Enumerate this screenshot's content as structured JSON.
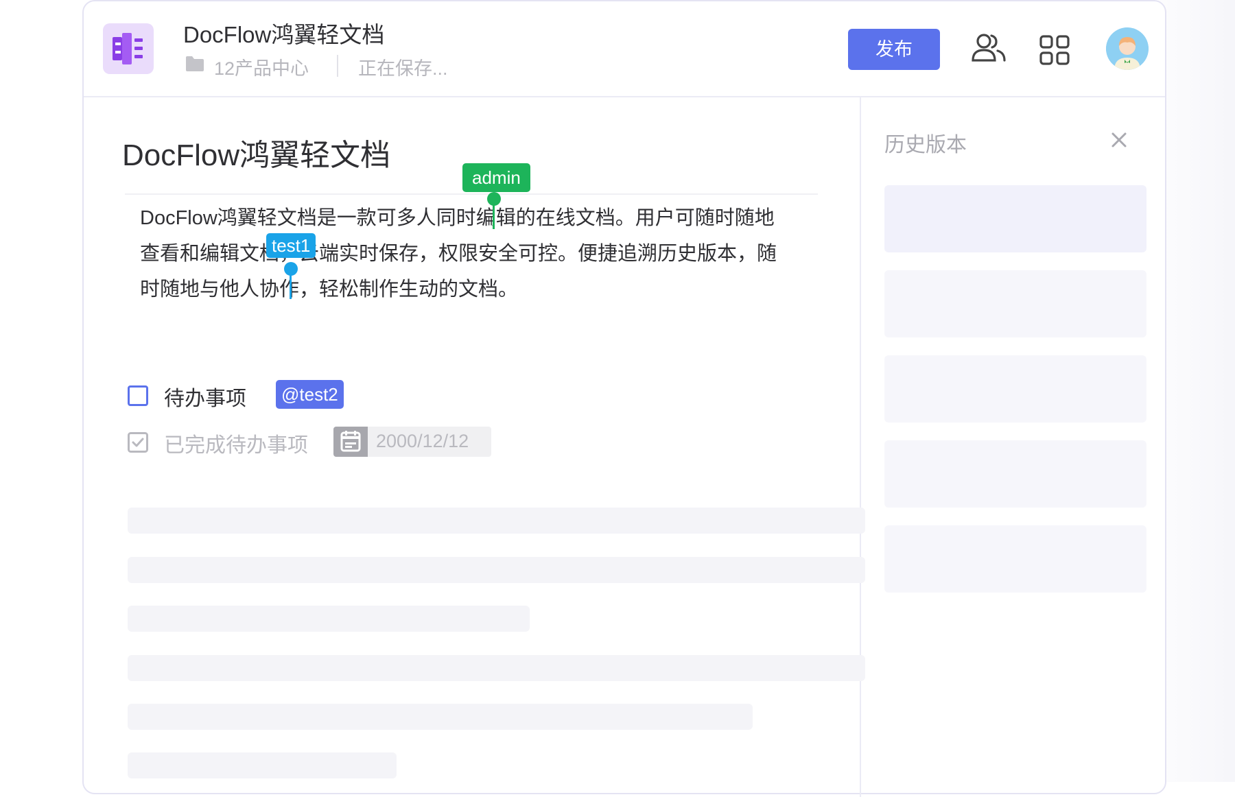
{
  "header": {
    "doc_title": "DocFlow鸿翼轻文档",
    "folder_name": "12产品中心",
    "save_status": "正在保存...",
    "publish_label": "发布"
  },
  "editor": {
    "title": "DocFlow鸿翼轻文档",
    "paragraph_lines": [
      "DocFlow鸿翼轻文档是一款可多人同时编辑的在线文档。用户可随时随地",
      "查看和编辑文档，云端实时保存，权限安全可控。便捷追溯历史版本，随",
      "时随地与他人协作，轻松制作生动的文档。"
    ],
    "cursor_users": [
      {
        "name": "admin",
        "color": "#1db45a"
      },
      {
        "name": "test1",
        "color": "#1aa3e8"
      }
    ],
    "todo": {
      "label": "待办事项",
      "mention": "@test2",
      "checked": false
    },
    "done_todo": {
      "label": "已完成待办事项",
      "date": "2000/12/12",
      "checked": true
    }
  },
  "history": {
    "title": "历史版本"
  },
  "colors": {
    "accent": "#5b72ec",
    "admin_cursor": "#1db45a",
    "test1_cursor": "#1aa3e8",
    "logo_bg": "#eadcfb",
    "logo_fg": "#8a3ee6"
  }
}
